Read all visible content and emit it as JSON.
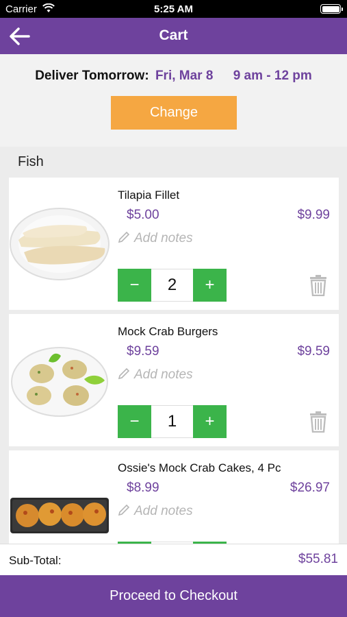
{
  "status_bar": {
    "carrier": "Carrier",
    "time": "5:25 AM"
  },
  "header": {
    "title": "Cart"
  },
  "delivery": {
    "label": "Deliver Tomorrow:",
    "date": "Fri, Mar 8",
    "slot": "9 am - 12 pm",
    "change_label": "Change"
  },
  "section": {
    "title": "Fish"
  },
  "items": [
    {
      "name": "Tilapia Fillet",
      "unit_price": "$5.00",
      "total": "$9.99",
      "notes_placeholder": "Add notes",
      "qty": "2",
      "image": "tilapia-fillet-photo"
    },
    {
      "name": "Mock Crab Burgers",
      "unit_price": "$9.59",
      "total": "$9.59",
      "notes_placeholder": "Add notes",
      "qty": "1",
      "image": "crab-burgers-photo"
    },
    {
      "name": "Ossie's Mock Crab Cakes, 4 Pc",
      "unit_price": "$8.99",
      "total": "$26.97",
      "notes_placeholder": "Add notes",
      "qty": "",
      "image": "crab-cakes-photo"
    }
  ],
  "stepper": {
    "minus": "−",
    "plus": "+"
  },
  "footer": {
    "subtotal_label": "Sub-Total:",
    "subtotal_value": "$55.81",
    "checkout_label": "Proceed to Checkout"
  },
  "colors": {
    "brand_purple": "#6e429d",
    "change_orange": "#f5a742",
    "stepper_green": "#3bb44a"
  }
}
